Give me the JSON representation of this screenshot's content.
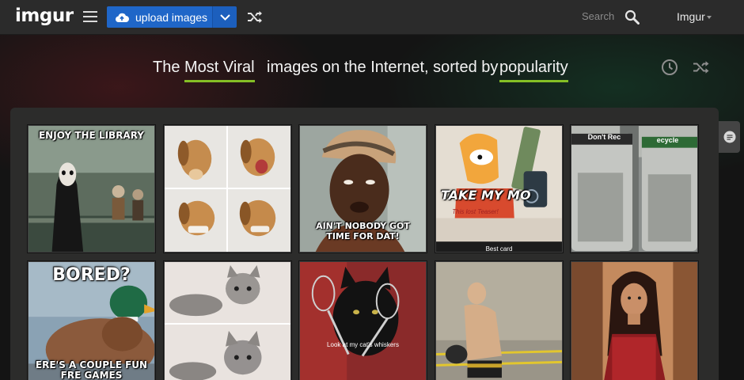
{
  "header": {
    "logo": "imgur",
    "menu_icon": "hamburger-menu-icon",
    "upload_label": "upload images",
    "upload_icon": "cloud-upload-icon",
    "upload_dropdown_icon": "chevron-down-icon",
    "random_icon": "shuffle-icon",
    "search_placeholder": "Search",
    "search_icon": "search-icon",
    "account_label": "Imgur",
    "account_caret_icon": "caret-down-icon"
  },
  "heading": {
    "prefix": "The",
    "section": "Most Viral",
    "middle": "images on the Internet, sorted by",
    "sort": "popularity",
    "clock_icon": "clock-icon",
    "random_icon": "shuffle-icon"
  },
  "colors": {
    "accent_underline": "#85bf25",
    "upload_button": "#1f66c8",
    "topbar": "#2b2b2b",
    "panel": "#2c2c2b"
  },
  "side_tab": {
    "icon": "comment-icon"
  },
  "gallery": [
    {
      "caption": "ENJOY THE LIBRARY"
    },
    {
      "caption": ""
    },
    {
      "caption": "AIN'T NOBODY GOT TIME FOR DAT!"
    },
    {
      "caption": "TAKE MY MO",
      "handwriting": "This lost Teaser!",
      "sub": "Best card"
    },
    {
      "caption": "",
      "sign": "Don't Rec",
      "sign2": "ecycle"
    },
    {
      "caption": "BORED?",
      "caption_bottom": "ERE'S A COUPLE FUN FRE GAMES"
    },
    {
      "caption": ""
    },
    {
      "caption": "",
      "sub": "Look at my cat's whiskers"
    },
    {
      "caption": ""
    },
    {
      "caption": ""
    }
  ]
}
